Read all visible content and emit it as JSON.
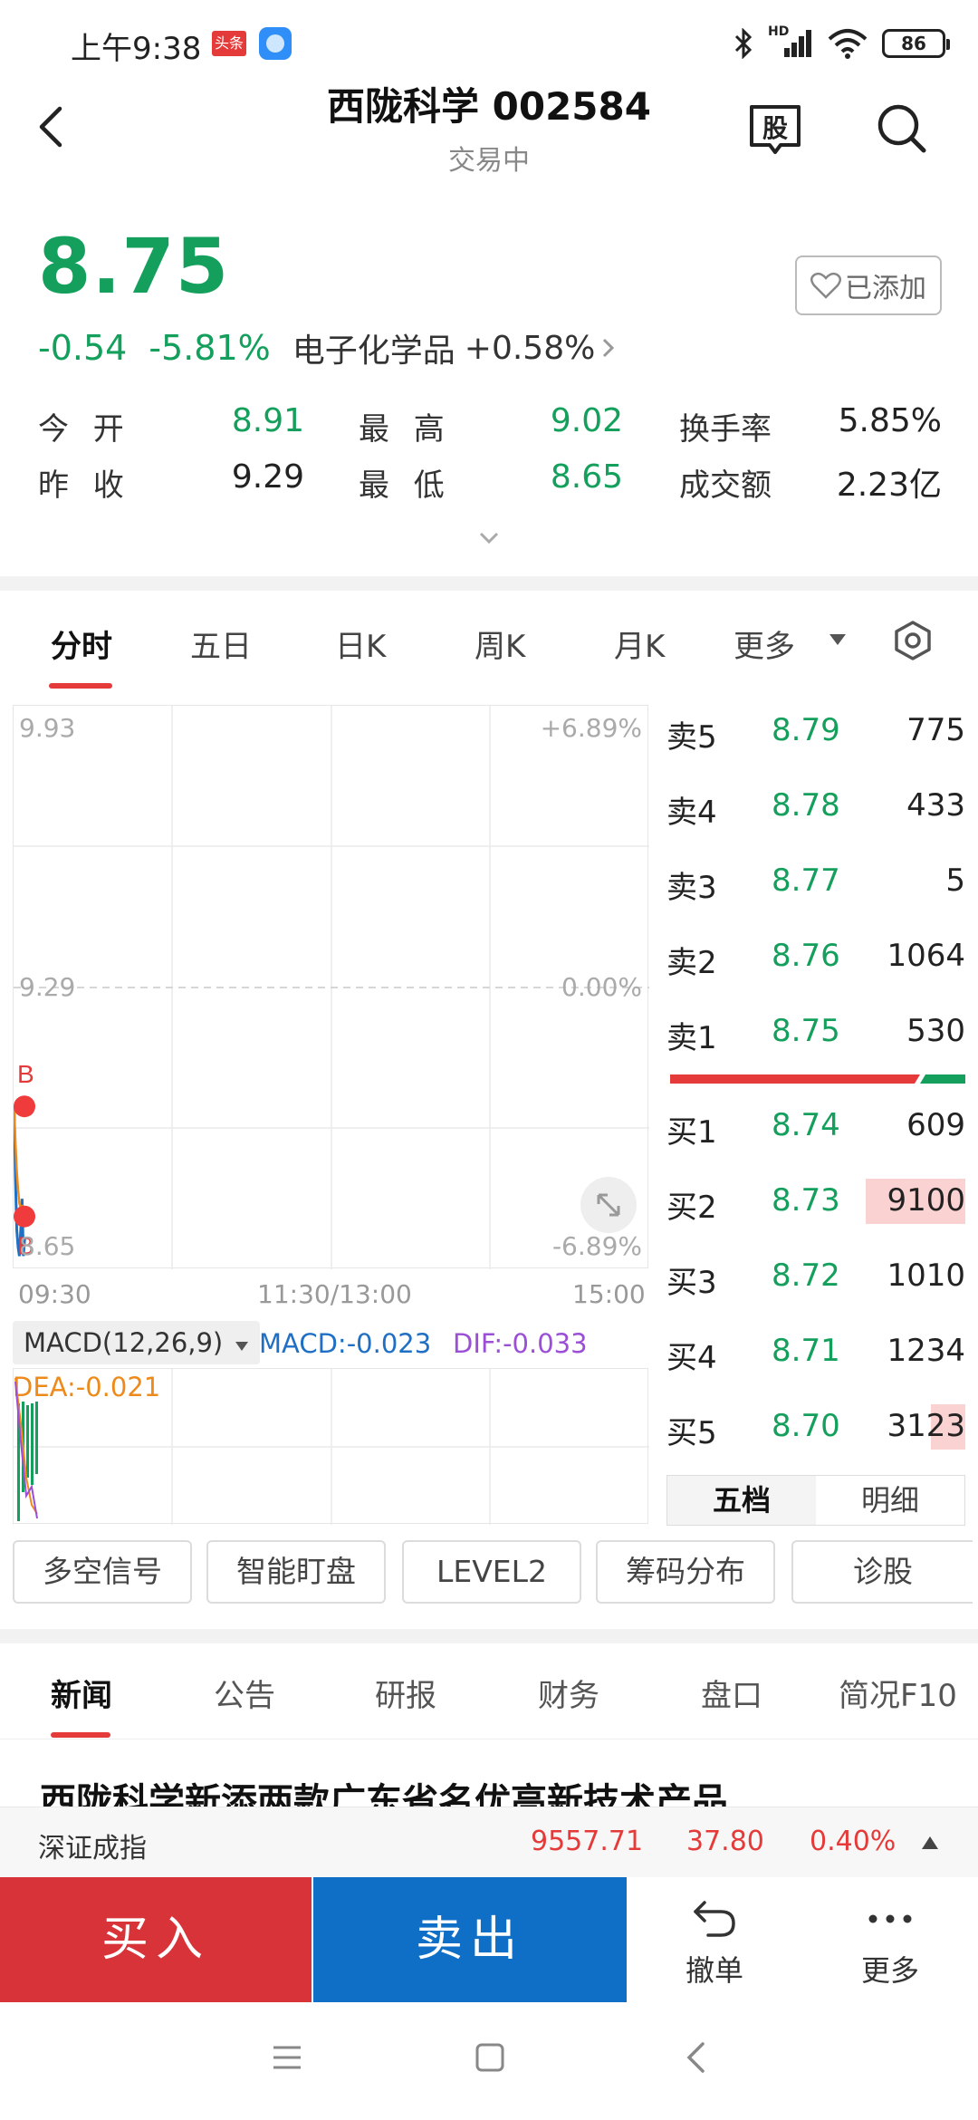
{
  "status_bar": {
    "time": "上午9:38",
    "app_badge": "头条",
    "network": "HD",
    "battery": "86"
  },
  "header": {
    "title": "西陇科学 002584",
    "status": "交易中",
    "gu_label": "股"
  },
  "quote": {
    "price": "8.75",
    "change": "-0.54",
    "change_pct": "-5.81%",
    "sector_name": "电子化学品",
    "sector_change": "+0.58%",
    "watch_label": "已添加",
    "colors": {
      "down": "#14a05c",
      "up": "#e53a3a"
    }
  },
  "stats": {
    "open_label": "今 开",
    "open": "8.91",
    "high_label": "最 高",
    "high": "9.02",
    "turnover_rate_label": "换手率",
    "turnover_rate": "5.85%",
    "prev_close_label": "昨 收",
    "prev_close": "9.29",
    "low_label": "最 低",
    "low": "8.65",
    "amount_label": "成交额",
    "amount": "2.23亿"
  },
  "chart_tabs": [
    "分时",
    "五日",
    "日K",
    "周K",
    "月K",
    "更多"
  ],
  "chart_data": {
    "type": "line",
    "y_ticks_left": [
      "9.93",
      "9.29",
      "8.65"
    ],
    "y_ticks_right": [
      "+6.89%",
      "0.00%",
      "-6.89%"
    ],
    "x_ticks": [
      "09:30",
      "11:30/13:00",
      "15:00"
    ],
    "ylim": [
      8.65,
      9.93
    ],
    "prev_close": 9.29,
    "markers": [
      {
        "label": "B",
        "price": 9.02,
        "minute": 0
      },
      {
        "label": "B",
        "price": 8.77,
        "minute": 3
      }
    ],
    "series": [
      {
        "values": [
          9.02,
          8.86,
          8.74,
          8.7,
          8.68,
          8.74,
          8.81,
          8.68,
          8.72
        ]
      }
    ]
  },
  "order_book": {
    "asks": [
      {
        "label": "卖5",
        "price": "8.79",
        "volume": "775"
      },
      {
        "label": "卖4",
        "price": "8.78",
        "volume": "433"
      },
      {
        "label": "卖3",
        "price": "8.77",
        "volume": "5"
      },
      {
        "label": "卖2",
        "price": "8.76",
        "volume": "1064"
      },
      {
        "label": "卖1",
        "price": "8.75",
        "volume": "530"
      }
    ],
    "bids": [
      {
        "label": "买1",
        "price": "8.74",
        "volume": "609"
      },
      {
        "label": "买2",
        "price": "8.73",
        "volume": "9100"
      },
      {
        "label": "买3",
        "price": "8.72",
        "volume": "1010"
      },
      {
        "label": "买4",
        "price": "8.71",
        "volume": "1234"
      },
      {
        "label": "买5",
        "price": "8.70",
        "volume": "3123"
      }
    ],
    "tabs": [
      "五档",
      "明细"
    ]
  },
  "macd": {
    "selector": "MACD(12,26,9)",
    "macd": "MACD:-0.023",
    "dif": "DIF:-0.033",
    "dea": "DEA:-0.021"
  },
  "tools": [
    "多空信号",
    "智能盯盘",
    "LEVEL2",
    "筹码分布",
    "诊股"
  ],
  "news_tabs": [
    "新闻",
    "公告",
    "研报",
    "财务",
    "盘口",
    "简况F10"
  ],
  "news_headline": "西陇科学新添两款广东省名优高新技术产品",
  "index_bar": {
    "name": "深证成指",
    "value": "9557.71",
    "change": "37.80",
    "change_pct": "0.40%"
  },
  "actions": {
    "buy": "买入",
    "sell": "卖出",
    "cancel": "撤单",
    "more": "更多"
  }
}
